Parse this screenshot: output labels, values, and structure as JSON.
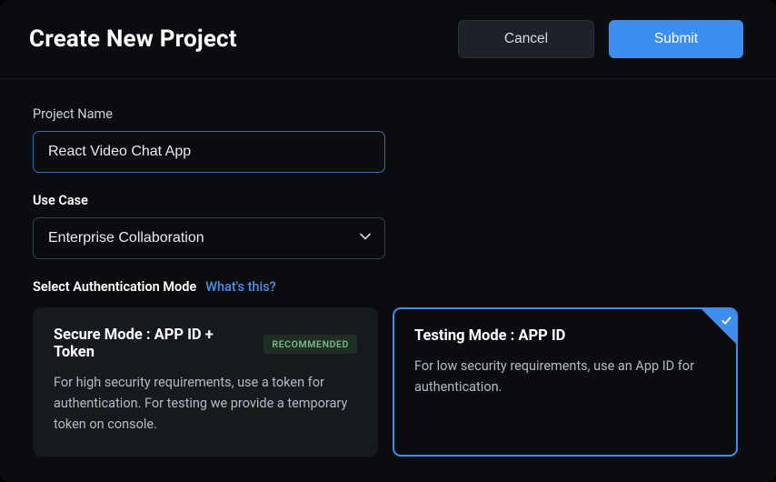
{
  "header": {
    "title": "Create New Project",
    "cancel": "Cancel",
    "submit": "Submit"
  },
  "projectName": {
    "label": "Project Name",
    "value": "React Video Chat App"
  },
  "useCase": {
    "label": "Use Case",
    "value": "Enterprise Collaboration"
  },
  "authMode": {
    "label": "Select Authentication Mode",
    "link": "What's this?"
  },
  "cards": {
    "secure": {
      "title": "Secure Mode : APP ID + Token",
      "badge": "RECOMMENDED",
      "desc": "For high security requirements, use a token for authentication. For testing we provide a temporary token on console."
    },
    "testing": {
      "title": "Testing Mode : APP ID",
      "desc": "For low security requirements, use an App ID for authentication."
    }
  }
}
